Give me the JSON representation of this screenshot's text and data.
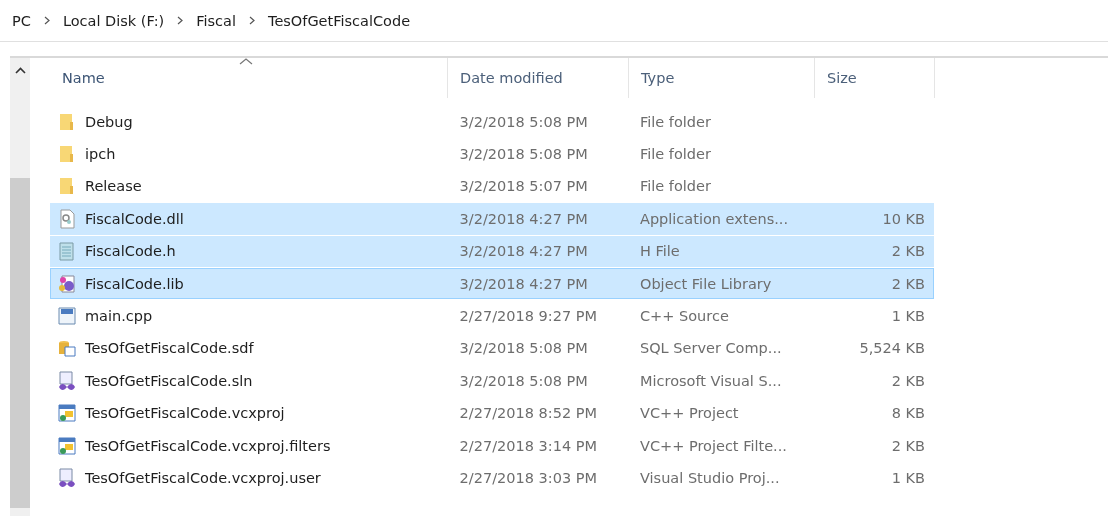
{
  "breadcrumb": [
    "PC",
    "Local Disk (F:)",
    "Fiscal",
    "TesOfGetFiscalCode"
  ],
  "columns": [
    {
      "label": "Name",
      "sorted": true
    },
    {
      "label": "Date modified",
      "sorted": false
    },
    {
      "label": "Type",
      "sorted": false
    },
    {
      "label": "Size",
      "sorted": false
    }
  ],
  "rows": [
    {
      "kind": "folder",
      "name": "Debug",
      "date": "3/2/2018 5:08 PM",
      "type": "File folder",
      "selected": false,
      "focused": false
    },
    {
      "kind": "folder",
      "name": "ipch",
      "date": "3/2/2018 5:08 PM",
      "type": "File folder",
      "selected": false,
      "focused": false
    },
    {
      "kind": "folder",
      "name": "Release",
      "date": "3/2/2018 5:07 PM",
      "type": "File folder",
      "selected": false,
      "focused": false
    },
    {
      "kind": "dll",
      "name": "FiscalCode.dll",
      "date": "3/2/2018 4:27 PM",
      "type": "Application extens...",
      "size": "10 KB",
      "selected": true,
      "focused": false
    },
    {
      "kind": "header",
      "name": "FiscalCode.h",
      "date": "3/2/2018 4:27 PM",
      "type": "H File",
      "size": "2 KB",
      "selected": true,
      "focused": false
    },
    {
      "kind": "lib",
      "name": "FiscalCode.lib",
      "date": "3/2/2018 4:27 PM",
      "type": "Object File Library",
      "size": "2 KB",
      "selected": true,
      "focused": true
    },
    {
      "kind": "cpp",
      "name": "main.cpp",
      "date": "2/27/2018 9:27 PM",
      "type": "C++ Source",
      "size": "1 KB",
      "selected": false,
      "focused": false
    },
    {
      "kind": "sdf",
      "name": "TesOfGetFiscalCode.sdf",
      "date": "3/2/2018 5:08 PM",
      "type": "SQL Server Comp...",
      "size": "5,524 KB",
      "selected": false,
      "focused": false
    },
    {
      "kind": "sln",
      "name": "TesOfGetFiscalCode.sln",
      "date": "3/2/2018 5:08 PM",
      "type": "Microsoft Visual S...",
      "size": "2 KB",
      "selected": false,
      "focused": false
    },
    {
      "kind": "vcxproj",
      "name": "TesOfGetFiscalCode.vcxproj",
      "date": "2/27/2018 8:52 PM",
      "type": "VC++ Project",
      "size": "8 KB",
      "selected": false,
      "focused": false
    },
    {
      "kind": "filters",
      "name": "TesOfGetFiscalCode.vcxproj.filters",
      "date": "2/27/2018 3:14 PM",
      "type": "VC++ Project Filte...",
      "size": "2 KB",
      "selected": false,
      "focused": false
    },
    {
      "kind": "user",
      "name": "TesOfGetFiscalCode.vcxproj.user",
      "date": "2/27/2018 3:03 PM",
      "type": "Visual Studio Proj...",
      "size": "1 KB",
      "selected": false,
      "focused": false
    }
  ]
}
